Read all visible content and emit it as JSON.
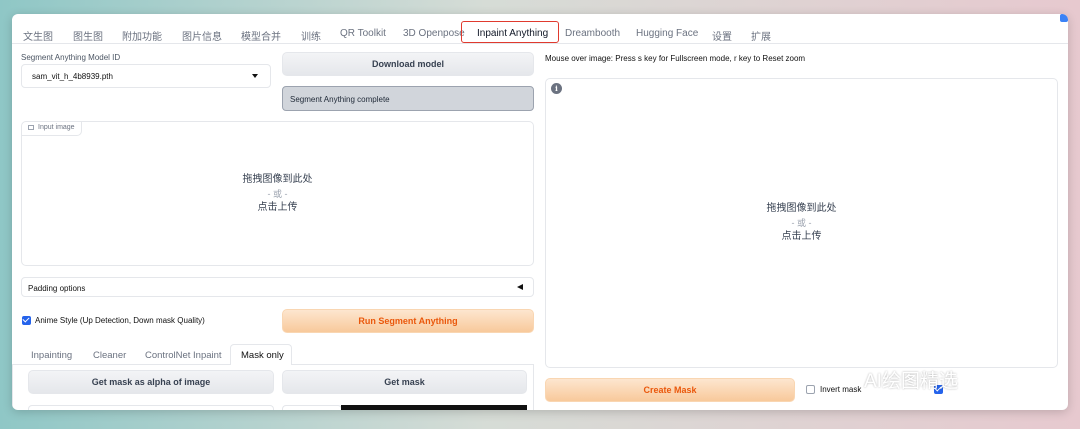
{
  "nav": {
    "tabs": [
      "文生图",
      "图生图",
      "附加功能",
      "图片信息",
      "模型合并",
      "训练",
      "QR Toolkit",
      "3D Openpose",
      "Inpaint Anything",
      "Dreambooth",
      "Hugging Face",
      "设置",
      "扩展"
    ],
    "active": "Inpaint Anything"
  },
  "left": {
    "model_label": "Segment Anything Model ID",
    "model_value": "sam_vit_h_4b8939.pth",
    "download_button": "Download model",
    "status_text": "Segment Anything complete",
    "input_image_label": "Input image",
    "drop_text": "拖拽图像到此处",
    "drop_or": "- 或 -",
    "drop_upload": "点击上传",
    "padding_options": "Padding options",
    "anime_style_label": "Anime Style (Up Detection, Down mask Quality)",
    "anime_style_checked": true,
    "run_button": "Run Segment Anything",
    "subtabs": [
      "Inpainting",
      "Cleaner",
      "ControlNet Inpaint",
      "Mask only"
    ],
    "active_subtab": "Mask only",
    "get_mask_alpha_button": "Get mask as alpha of image",
    "get_mask_button": "Get mask"
  },
  "right": {
    "hint": "Mouse over image: Press s key for Fullscreen mode, r key to Reset zoom",
    "drop_text": "拖拽图像到此处",
    "drop_or": "- 或 -",
    "drop_upload": "点击上传",
    "create_mask_button": "Create Mask",
    "invert_mask_label": "Invert mask",
    "invert_mask_checked": false
  },
  "watermark": "AI绘图精选",
  "colors": {
    "accent": "#ea580c",
    "highlight_box": "#e03a2e",
    "checkbox": "#2563eb"
  }
}
